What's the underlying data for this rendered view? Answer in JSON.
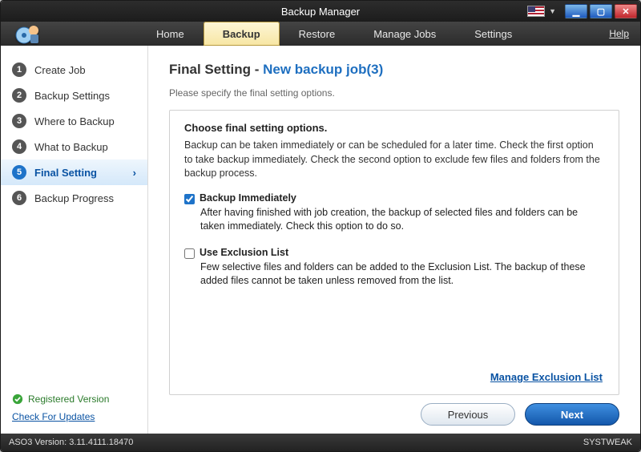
{
  "title": "Backup Manager",
  "menu": {
    "tabs": [
      "Home",
      "Backup",
      "Restore",
      "Manage Jobs",
      "Settings"
    ],
    "active_index": 1,
    "help": "Help"
  },
  "sidebar": {
    "steps": [
      {
        "num": "1",
        "label": "Create Job"
      },
      {
        "num": "2",
        "label": "Backup Settings"
      },
      {
        "num": "3",
        "label": "Where to Backup"
      },
      {
        "num": "4",
        "label": "What to Backup"
      },
      {
        "num": "5",
        "label": "Final Setting"
      },
      {
        "num": "6",
        "label": "Backup Progress"
      }
    ],
    "active_index": 4,
    "registered": "Registered Version",
    "check_updates": "Check For Updates"
  },
  "page": {
    "title_prefix": "Final Setting - ",
    "job_name": "New backup job(3)",
    "subtitle": "Please specify the final setting options.",
    "heading": "Choose final setting options.",
    "intro": "Backup can be taken immediately or can be scheduled for a later time. Check the first option to take backup immediately. Check the second option to exclude few files and folders from the backup process.",
    "opt1_label": "Backup Immediately",
    "opt1_checked": true,
    "opt1_desc": "After having finished with job creation, the backup of selected files and folders can be taken immediately. Check this option to do so.",
    "opt2_label": "Use Exclusion List",
    "opt2_checked": false,
    "opt2_desc": "Few selective files and folders can be added to the Exclusion List. The backup of these added files cannot be taken unless removed from the list.",
    "manage_link": "Manage Exclusion List"
  },
  "buttons": {
    "prev": "Previous",
    "next": "Next"
  },
  "status": {
    "version": "ASO3 Version: 3.11.4111.18470",
    "brand": "SYSTWEAK"
  }
}
